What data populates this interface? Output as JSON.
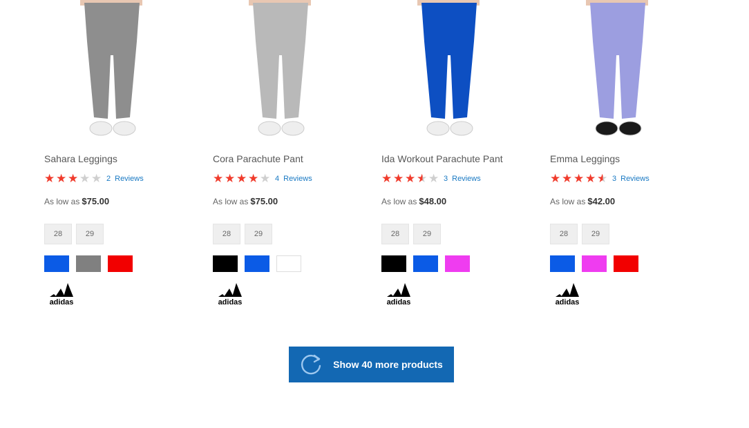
{
  "products": [
    {
      "name": "Sahara Leggings",
      "rating": 3,
      "review_count": "2",
      "reviews_label": "Reviews",
      "price_prefix": "As low as",
      "price": "$75.00",
      "sizes": [
        "28",
        "29"
      ],
      "swatches": [
        "#0b5be6",
        "#808080",
        "#f20000"
      ],
      "brand": "adidas",
      "garment_color": "#8e8e8e",
      "shoe_color": "#eeeeee"
    },
    {
      "name": "Cora Parachute Pant",
      "rating": 4,
      "review_count": "4",
      "reviews_label": "Reviews",
      "price_prefix": "As low as",
      "price": "$75.00",
      "sizes": [
        "28",
        "29"
      ],
      "swatches": [
        "#000000",
        "#0b5be6",
        "#ffffff"
      ],
      "brand": "adidas",
      "garment_color": "#b9b9b9",
      "shoe_color": "#eeeeee"
    },
    {
      "name": "Ida Workout Parachute Pant",
      "rating": 3.5,
      "review_count": "3",
      "reviews_label": "Reviews",
      "price_prefix": "As low as",
      "price": "$48.00",
      "sizes": [
        "28",
        "29"
      ],
      "swatches": [
        "#000000",
        "#0b5be6",
        "#ef3cf0"
      ],
      "brand": "adidas",
      "garment_color": "#0d4fc2",
      "shoe_color": "#eeeeee"
    },
    {
      "name": "Emma Leggings",
      "rating": 4.5,
      "review_count": "3",
      "reviews_label": "Reviews",
      "price_prefix": "As low as",
      "price": "$42.00",
      "sizes": [
        "28",
        "29"
      ],
      "swatches": [
        "#0b5be6",
        "#ef3cf0",
        "#f20000"
      ],
      "brand": "adidas",
      "garment_color": "#9c9ee0",
      "shoe_color": "#1a1a1a"
    }
  ],
  "load_more": {
    "label": "Show 40 more products",
    "icon": "refresh-icon"
  },
  "colors": {
    "star_filled": "#f03b2c",
    "star_empty": "#cfcfcf",
    "link": "#1979c3",
    "button": "#1368b3"
  }
}
